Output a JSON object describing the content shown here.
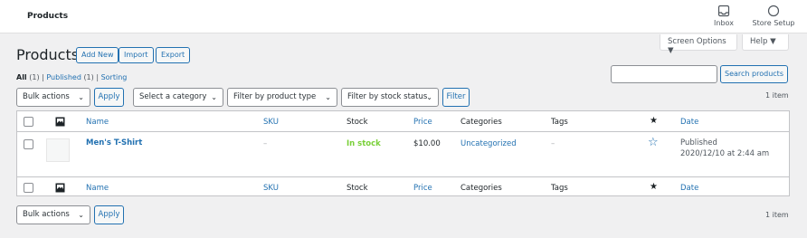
{
  "topbar": {
    "breadcrumb": "Products",
    "inbox": "Inbox",
    "store_setup": "Store Setup"
  },
  "screen_tabs": {
    "screen_options": "Screen Options ▼",
    "help": "Help ▼"
  },
  "page": {
    "title": "Products",
    "add_new": "Add New",
    "import": "Import",
    "export": "Export"
  },
  "views": {
    "all": "All",
    "all_count": "(1)",
    "sep1": "|",
    "published": "Published",
    "published_count": "(1)",
    "sep2": "|",
    "sorting": "Sorting"
  },
  "search": {
    "button": "Search products",
    "value": ""
  },
  "filters": {
    "bulk_actions": "Bulk actions",
    "apply": "Apply",
    "category": "Select a category",
    "product_type": "Filter by product type",
    "stock_status": "Filter by stock status",
    "filter": "Filter",
    "item_count": "1 item"
  },
  "table": {
    "columns": {
      "name": "Name",
      "sku": "SKU",
      "stock": "Stock",
      "price": "Price",
      "categories": "Categories",
      "tags": "Tags",
      "date": "Date"
    },
    "rows": [
      {
        "name": "Men's T-Shirt",
        "sku": "–",
        "stock": "In stock",
        "price": "$10.00",
        "categories": "Uncategorized",
        "tags": "–",
        "date_status": "Published",
        "date_value": "2020/12/10 at 2:44 am"
      }
    ]
  },
  "bottom": {
    "bulk_actions": "Bulk actions",
    "apply": "Apply",
    "item_count": "1 item"
  },
  "colors": {
    "link": "#2271b1",
    "in_stock": "#7ad03a",
    "background": "#f0f0f1"
  },
  "icons": {
    "inbox": "inbox-icon",
    "store_setup": "circle-icon",
    "image_column": "image-icon",
    "featured_column": "star-icon",
    "featured_toggle": "star-outline-icon"
  }
}
